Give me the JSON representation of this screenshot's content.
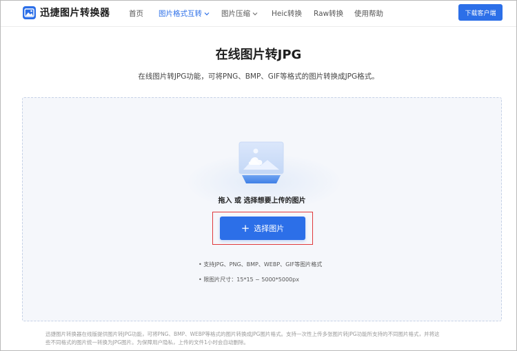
{
  "app": {
    "logo_text": "迅捷图片转换器"
  },
  "nav": {
    "items": [
      {
        "label": "首页"
      },
      {
        "label": "图片格式互转",
        "active": true
      },
      {
        "label": "图片压缩"
      },
      {
        "label": "Heic转换"
      },
      {
        "label": "Raw转换"
      },
      {
        "label": "使用帮助"
      }
    ],
    "download_label": "下载客户端"
  },
  "main": {
    "title": "在线图片转JPG",
    "subtitle": "在线图片转JPG功能，可将PNG、BMP、GIF等格式的图片转换成JPG格式。",
    "drop_text": "拖入 或 选择想要上传的图片",
    "select_label": "选择图片",
    "hints": [
      "• 支持JPG、PNG、BMP、WEBP、GIF等图片格式",
      "• 限图片尺寸：15*15 ~ 5000*5000px"
    ]
  },
  "footer": {
    "line1": "迅捷图片转换器在线版提供图片转JPG功能，可将PNG、BMP、WEBP等格式的图片转换成JPG图片格式。支持一次性上传多张图片转JPG功能所支持的不同图片格式，并将这",
    "line2": "些不同格式的图片统一转换为JPG图片。为保障用户隐私，上传的文件1小时会自动删除。"
  },
  "colors": {
    "accent": "#2c6fe8",
    "highlight": "#e0383b",
    "dropzone_bg": "#f5f7fb"
  },
  "icons": {
    "logo": "image-icon",
    "chevron": "chevron-down-icon",
    "plus": "plus-icon",
    "illustration": "picture-icon"
  }
}
